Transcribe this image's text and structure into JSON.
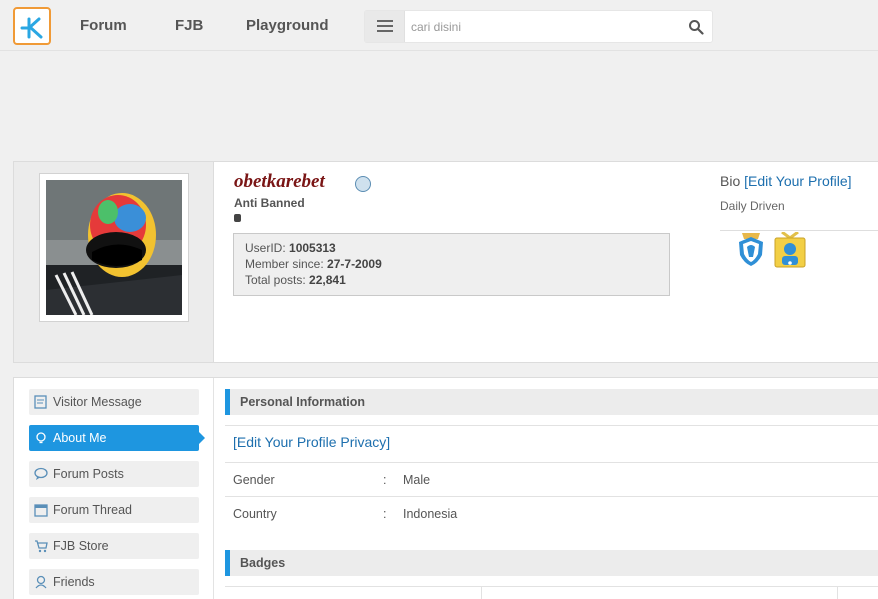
{
  "nav": {
    "links": [
      "Forum",
      "FJB",
      "Playground"
    ],
    "search_placeholder": "cari disini"
  },
  "profile": {
    "username": "obetkarebet",
    "user_title": "Anti Banned",
    "stats": {
      "userid_label": "UserID:",
      "userid": "1005313",
      "since_label": "Member since:",
      "since": "27-7-2009",
      "posts_label": "Total posts:",
      "posts": "22,841"
    },
    "bio_label": "Bio",
    "bio_edit": "[Edit Your Profile]",
    "bio_text": "Daily Driven"
  },
  "sidebar": {
    "items": [
      {
        "label": "Visitor Message",
        "icon": "note-icon"
      },
      {
        "label": "About Me",
        "icon": "bulb-icon"
      },
      {
        "label": "Forum Posts",
        "icon": "chat-icon"
      },
      {
        "label": "Forum Thread",
        "icon": "calendar-icon"
      },
      {
        "label": "FJB Store",
        "icon": "cart-icon"
      },
      {
        "label": "Friends",
        "icon": "friends-icon"
      }
    ],
    "active": "About Me"
  },
  "about": {
    "personal_header": "Personal Information",
    "privacy_link": "[Edit Your Profile Privacy]",
    "rows": [
      {
        "key": "Gender",
        "sep": ":",
        "value": "Male"
      },
      {
        "key": "Country",
        "sep": ":",
        "value": "Indonesia"
      }
    ],
    "badges_header": "Badges"
  },
  "colors": {
    "accent": "#1e96e0",
    "logo": "#f09a36",
    "username": "#7a1515",
    "link": "#1d6fae"
  }
}
